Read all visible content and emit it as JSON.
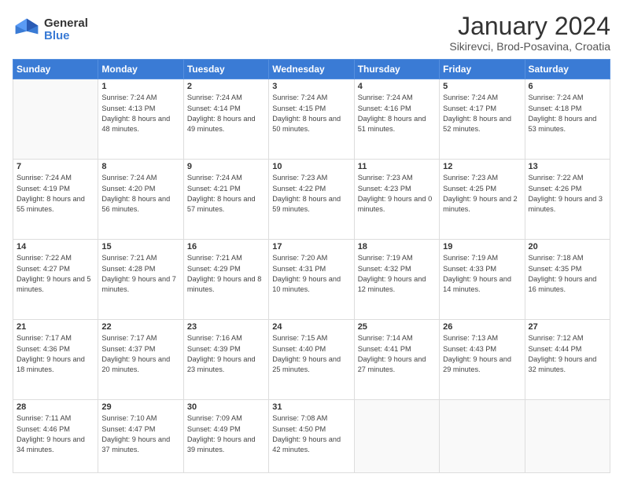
{
  "logo": {
    "general": "General",
    "blue": "Blue"
  },
  "header": {
    "month": "January 2024",
    "location": "Sikirevci, Brod-Posavina, Croatia"
  },
  "days_of_week": [
    "Sunday",
    "Monday",
    "Tuesday",
    "Wednesday",
    "Thursday",
    "Friday",
    "Saturday"
  ],
  "weeks": [
    [
      {
        "day": "",
        "info": ""
      },
      {
        "day": "1",
        "info": "Sunrise: 7:24 AM\nSunset: 4:13 PM\nDaylight: 8 hours\nand 48 minutes."
      },
      {
        "day": "2",
        "info": "Sunrise: 7:24 AM\nSunset: 4:14 PM\nDaylight: 8 hours\nand 49 minutes."
      },
      {
        "day": "3",
        "info": "Sunrise: 7:24 AM\nSunset: 4:15 PM\nDaylight: 8 hours\nand 50 minutes."
      },
      {
        "day": "4",
        "info": "Sunrise: 7:24 AM\nSunset: 4:16 PM\nDaylight: 8 hours\nand 51 minutes."
      },
      {
        "day": "5",
        "info": "Sunrise: 7:24 AM\nSunset: 4:17 PM\nDaylight: 8 hours\nand 52 minutes."
      },
      {
        "day": "6",
        "info": "Sunrise: 7:24 AM\nSunset: 4:18 PM\nDaylight: 8 hours\nand 53 minutes."
      }
    ],
    [
      {
        "day": "7",
        "info": "Sunrise: 7:24 AM\nSunset: 4:19 PM\nDaylight: 8 hours\nand 55 minutes."
      },
      {
        "day": "8",
        "info": "Sunrise: 7:24 AM\nSunset: 4:20 PM\nDaylight: 8 hours\nand 56 minutes."
      },
      {
        "day": "9",
        "info": "Sunrise: 7:24 AM\nSunset: 4:21 PM\nDaylight: 8 hours\nand 57 minutes."
      },
      {
        "day": "10",
        "info": "Sunrise: 7:23 AM\nSunset: 4:22 PM\nDaylight: 8 hours\nand 59 minutes."
      },
      {
        "day": "11",
        "info": "Sunrise: 7:23 AM\nSunset: 4:23 PM\nDaylight: 9 hours\nand 0 minutes."
      },
      {
        "day": "12",
        "info": "Sunrise: 7:23 AM\nSunset: 4:25 PM\nDaylight: 9 hours\nand 2 minutes."
      },
      {
        "day": "13",
        "info": "Sunrise: 7:22 AM\nSunset: 4:26 PM\nDaylight: 9 hours\nand 3 minutes."
      }
    ],
    [
      {
        "day": "14",
        "info": "Sunrise: 7:22 AM\nSunset: 4:27 PM\nDaylight: 9 hours\nand 5 minutes."
      },
      {
        "day": "15",
        "info": "Sunrise: 7:21 AM\nSunset: 4:28 PM\nDaylight: 9 hours\nand 7 minutes."
      },
      {
        "day": "16",
        "info": "Sunrise: 7:21 AM\nSunset: 4:29 PM\nDaylight: 9 hours\nand 8 minutes."
      },
      {
        "day": "17",
        "info": "Sunrise: 7:20 AM\nSunset: 4:31 PM\nDaylight: 9 hours\nand 10 minutes."
      },
      {
        "day": "18",
        "info": "Sunrise: 7:19 AM\nSunset: 4:32 PM\nDaylight: 9 hours\nand 12 minutes."
      },
      {
        "day": "19",
        "info": "Sunrise: 7:19 AM\nSunset: 4:33 PM\nDaylight: 9 hours\nand 14 minutes."
      },
      {
        "day": "20",
        "info": "Sunrise: 7:18 AM\nSunset: 4:35 PM\nDaylight: 9 hours\nand 16 minutes."
      }
    ],
    [
      {
        "day": "21",
        "info": "Sunrise: 7:17 AM\nSunset: 4:36 PM\nDaylight: 9 hours\nand 18 minutes."
      },
      {
        "day": "22",
        "info": "Sunrise: 7:17 AM\nSunset: 4:37 PM\nDaylight: 9 hours\nand 20 minutes."
      },
      {
        "day": "23",
        "info": "Sunrise: 7:16 AM\nSunset: 4:39 PM\nDaylight: 9 hours\nand 23 minutes."
      },
      {
        "day": "24",
        "info": "Sunrise: 7:15 AM\nSunset: 4:40 PM\nDaylight: 9 hours\nand 25 minutes."
      },
      {
        "day": "25",
        "info": "Sunrise: 7:14 AM\nSunset: 4:41 PM\nDaylight: 9 hours\nand 27 minutes."
      },
      {
        "day": "26",
        "info": "Sunrise: 7:13 AM\nSunset: 4:43 PM\nDaylight: 9 hours\nand 29 minutes."
      },
      {
        "day": "27",
        "info": "Sunrise: 7:12 AM\nSunset: 4:44 PM\nDaylight: 9 hours\nand 32 minutes."
      }
    ],
    [
      {
        "day": "28",
        "info": "Sunrise: 7:11 AM\nSunset: 4:46 PM\nDaylight: 9 hours\nand 34 minutes."
      },
      {
        "day": "29",
        "info": "Sunrise: 7:10 AM\nSunset: 4:47 PM\nDaylight: 9 hours\nand 37 minutes."
      },
      {
        "day": "30",
        "info": "Sunrise: 7:09 AM\nSunset: 4:49 PM\nDaylight: 9 hours\nand 39 minutes."
      },
      {
        "day": "31",
        "info": "Sunrise: 7:08 AM\nSunset: 4:50 PM\nDaylight: 9 hours\nand 42 minutes."
      },
      {
        "day": "",
        "info": ""
      },
      {
        "day": "",
        "info": ""
      },
      {
        "day": "",
        "info": ""
      }
    ]
  ]
}
